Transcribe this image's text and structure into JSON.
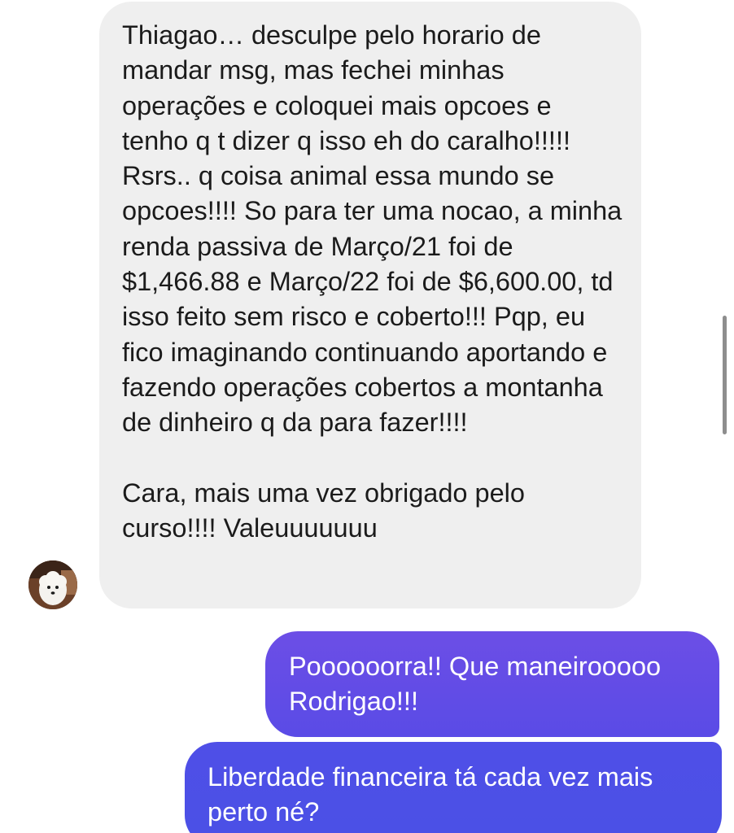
{
  "conversation": {
    "incoming": {
      "paragraph_1": "Thiagao… desculpe pelo horario de mandar msg, mas fechei minhas operações e coloquei mais opcoes e tenho q t dizer q isso eh do caralho!!!!! Rsrs.. q coisa animal essa mundo se opcoes!!!! So para ter uma nocao, a minha renda passiva de Março/21 foi de $1,466.88 e Março/22 foi de $6,600.00, td isso feito sem risco e coberto!!! Pqp, eu fico imaginando continuando aportando e fazendo operações cobertos a montanha de dinheiro q da para fazer!!!!",
      "paragraph_2": "Cara, mais uma vez obrigado pelo curso!!!! Valeuuuuuuu",
      "avatar_icon": "dog-avatar-icon"
    },
    "outgoing": [
      {
        "text": "Poooooorra!! Que maneirooooo Rodrigao!!!"
      },
      {
        "text": "Liberdade financeira tá cada vez mais perto né?"
      }
    ]
  },
  "colors": {
    "incoming_bubble": "#efefef",
    "outgoing_bubble_1": "#6652e6",
    "outgoing_bubble_2": "#4b50e6",
    "text_dark": "#1b1b1b",
    "text_light": "#ffffff"
  }
}
